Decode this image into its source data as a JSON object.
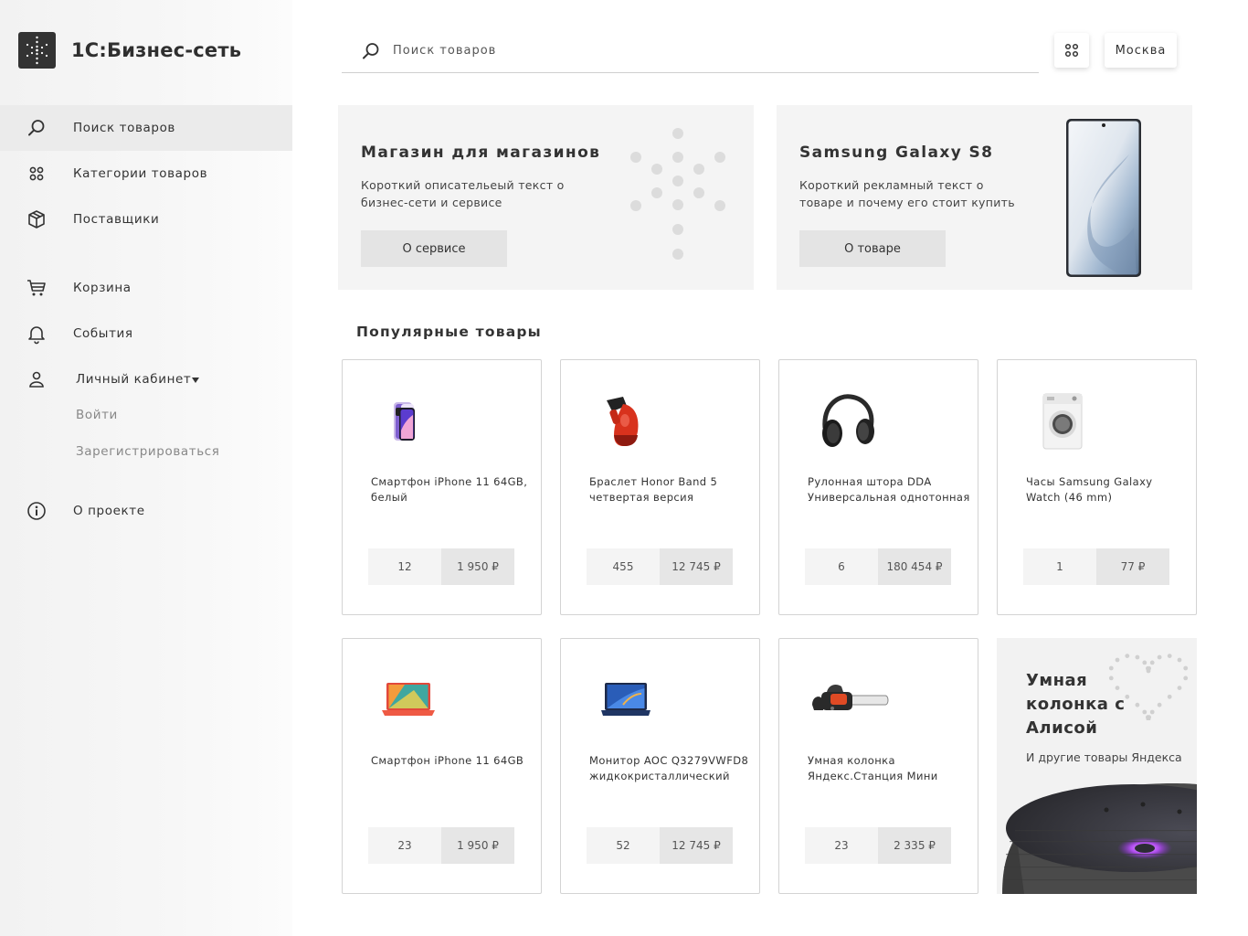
{
  "app": {
    "logo_text": "1С:Бизнес-сеть"
  },
  "sidebar": {
    "items": [
      {
        "label": "Поиск товаров",
        "icon": "search-icon"
      },
      {
        "label": "Категории товаров",
        "icon": "grid-icon"
      },
      {
        "label": "Поставщики",
        "icon": "box-icon"
      },
      {
        "label": "Корзина",
        "icon": "cart-icon"
      },
      {
        "label": "События",
        "icon": "bell-icon"
      },
      {
        "label": "Личный кабинет",
        "icon": "user-icon"
      },
      {
        "label": "О проекте",
        "icon": "info-icon"
      }
    ],
    "account_sub": {
      "login": "Войти",
      "register": "Зарегистрироваться"
    }
  },
  "header": {
    "search_placeholder": "Поиск товаров",
    "city": "Москва"
  },
  "promos": [
    {
      "title": "Магазин для магазинов",
      "text": "Короткий описательеый текст о бизнес-сети и сервисе",
      "button": "О сервисе"
    },
    {
      "title": "Samsung Galaxy S8",
      "text": "Короткий рекламный текст о товаре и почему его стоит купить",
      "button": "О товаре"
    }
  ],
  "popular": {
    "title": "Популярные товары",
    "products": [
      {
        "title": "Смартфон iPhone 11 64GB, белый",
        "qty": "12",
        "price": "1 950 ₽",
        "image": "iphone-image"
      },
      {
        "title": "Браслет Honor Band 5 четвертая версия",
        "qty": "455",
        "price": "12 745 ₽",
        "image": "steamer-image"
      },
      {
        "title": "Рулонная штора DDA Универсальная однотонная",
        "qty": "6",
        "price": "180 454 ₽",
        "image": "headphones-image"
      },
      {
        "title": "Часы Samsung Galaxy Watch (46 mm)",
        "qty": "1",
        "price": "77 ₽",
        "image": "washing-machine-image"
      },
      {
        "title": "Смартфон iPhone 11 64GB",
        "qty": "23",
        "price": "1 950 ₽",
        "image": "laptop-red-image"
      },
      {
        "title": "Монитор AOC Q3279VWFD8 жидкокристаллический",
        "qty": "52",
        "price": "12 745 ₽",
        "image": "laptop-blue-image"
      },
      {
        "title": "Умная колонка Яндекс.Станция Мини",
        "qty": "23",
        "price": "2 335 ₽",
        "image": "chainsaw-image"
      }
    ],
    "alice": {
      "title": "Умная колонка с Алисой",
      "subtitle": "И другие товары Яндекса"
    }
  }
}
